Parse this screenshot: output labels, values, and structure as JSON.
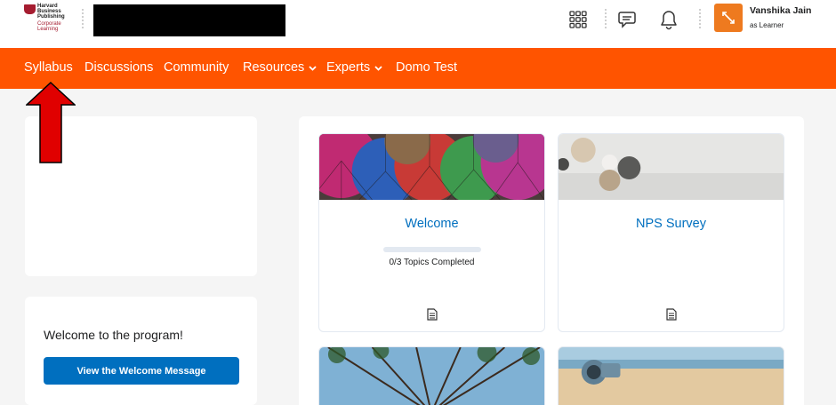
{
  "header": {
    "logo_lines": [
      "Harvard",
      "Business",
      "Publishing"
    ],
    "logo_sub": [
      "Corporate",
      "Learning"
    ],
    "user": {
      "name": "Vanshika Jain",
      "role": "as Learner"
    },
    "icons": [
      "grid-icon",
      "chat-icon",
      "bell-icon",
      "user-switch-icon"
    ]
  },
  "nav": {
    "items": [
      {
        "label": "Syllabus"
      },
      {
        "label": "Discussions"
      },
      {
        "label": "Community"
      },
      {
        "label": "Resources"
      },
      {
        "label": "Experts"
      },
      {
        "label": "Domo Test"
      }
    ]
  },
  "left": {
    "welcome_text": "Welcome to the program!",
    "welcome_button": "View the Welcome Message"
  },
  "tiles": [
    {
      "title": "Welcome",
      "progress_text": "0/3  Topics Completed",
      "progress": 0
    },
    {
      "title": "NPS Survey"
    }
  ],
  "colors": {
    "brand_orange": "#ff5400",
    "link_blue": "#006fbf",
    "avatar_orange": "#ee7a1f"
  }
}
